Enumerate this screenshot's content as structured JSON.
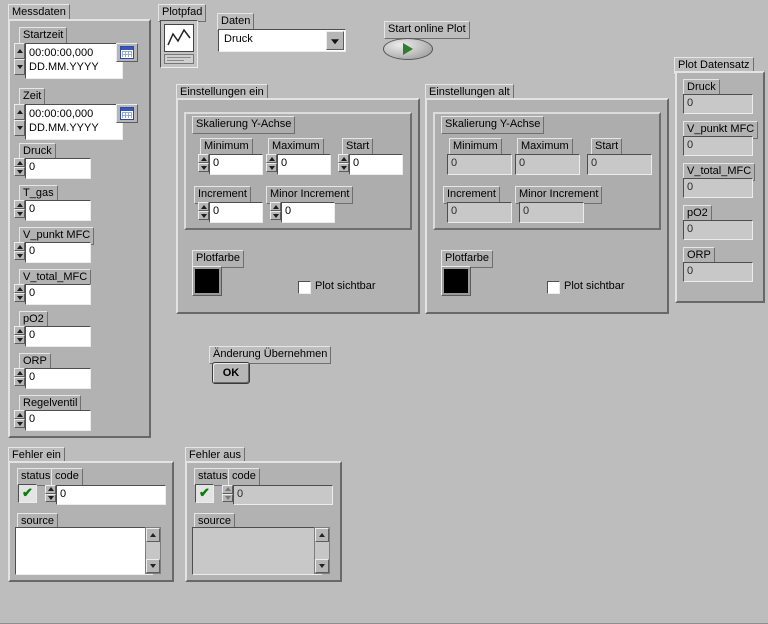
{
  "icons": {
    "checkmark": "✔"
  },
  "messdaten": {
    "title": "Messdaten",
    "time_fields": [
      {
        "label": "Startzeit",
        "time": "00:00:00,000",
        "date": "DD.MM.YYYY"
      },
      {
        "label": "Zeit",
        "time": "00:00:00,000",
        "date": "DD.MM.YYYY"
      }
    ],
    "numeric_fields": [
      {
        "label": "Druck",
        "value": "0"
      },
      {
        "label": "T_gas",
        "value": "0"
      },
      {
        "label": "V_punkt MFC",
        "value": "0"
      },
      {
        "label": "V_total_MFC",
        "value": "0"
      },
      {
        "label": "pO2",
        "value": "0"
      },
      {
        "label": "ORP",
        "value": "0"
      },
      {
        "label": "Regelventil",
        "value": "0"
      }
    ]
  },
  "plotpfad": {
    "title": "Plotpfad"
  },
  "daten": {
    "title": "Daten",
    "selected": "Druck"
  },
  "start_plot": {
    "title": "Start online Plot"
  },
  "einstellungen": [
    {
      "title": "Einstellungen ein",
      "group_title": "Skalierung Y-Achse",
      "fields": [
        {
          "label": "Minimum",
          "value": "0"
        },
        {
          "label": "Maximum",
          "value": "0"
        },
        {
          "label": "Start",
          "value": "0"
        },
        {
          "label": "Increment",
          "value": "0"
        },
        {
          "label": "Minor Increment",
          "value": "0"
        }
      ],
      "plotfarbe_label": "Plotfarbe",
      "plot_color": "#000000",
      "plot_sichtbar_label": "Plot sichtbar",
      "plot_sichtbar_checked": false
    },
    {
      "title": "Einstellungen alt",
      "group_title": "Skalierung Y-Achse",
      "fields": [
        {
          "label": "Minimum",
          "value": "0"
        },
        {
          "label": "Maximum",
          "value": "0"
        },
        {
          "label": "Start",
          "value": "0"
        },
        {
          "label": "Increment",
          "value": "0"
        },
        {
          "label": "Minor Increment",
          "value": "0"
        }
      ],
      "plotfarbe_label": "Plotfarbe",
      "plot_color": "#000000",
      "plot_sichtbar_label": "Plot sichtbar",
      "plot_sichtbar_checked": false
    }
  ],
  "aenderung": {
    "title": "Änderung Übernehmen",
    "ok_label": "OK"
  },
  "plot_datensatz": {
    "title": "Plot Datensatz",
    "fields": [
      {
        "label": "Druck",
        "value": "0"
      },
      {
        "label": "V_punkt MFC",
        "value": "0"
      },
      {
        "label": "V_total_MFC",
        "value": "0"
      },
      {
        "label": "pO2",
        "value": "0"
      },
      {
        "label": "ORP",
        "value": "0"
      }
    ]
  },
  "fehler": [
    {
      "title": "Fehler ein",
      "status_label": "status",
      "code_label": "code",
      "code_value": "0",
      "source_label": "source",
      "source_value": ""
    },
    {
      "title": "Fehler aus",
      "status_label": "status",
      "code_label": "code",
      "code_value": "0",
      "source_label": "source",
      "source_value": ""
    }
  ]
}
